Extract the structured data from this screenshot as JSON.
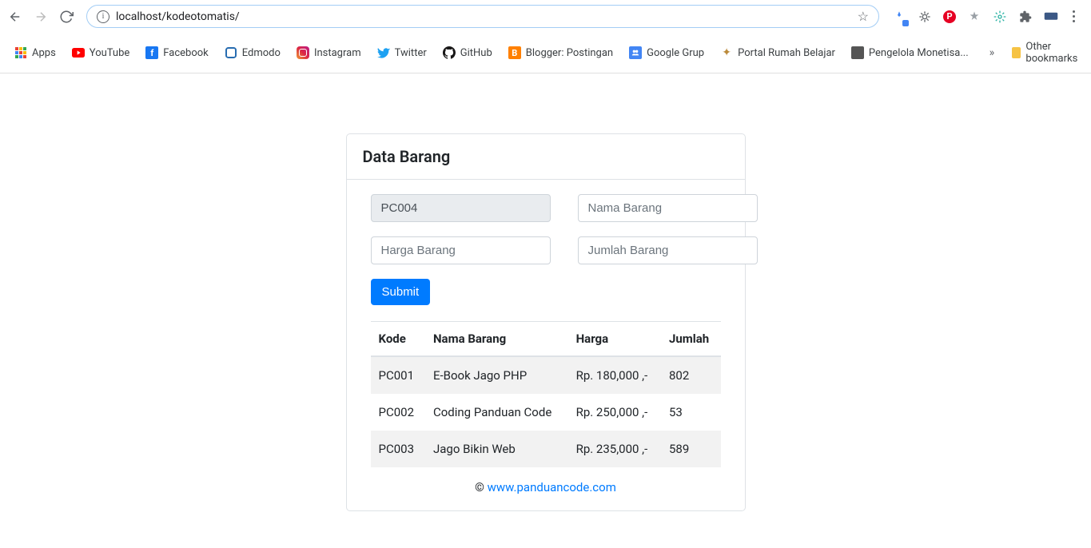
{
  "browser": {
    "url": "localhost/kodeotomatis/",
    "apps_label": "Apps",
    "other_bookmarks": "Other bookmarks"
  },
  "bookmarks": [
    {
      "label": "YouTube"
    },
    {
      "label": "Facebook"
    },
    {
      "label": "Edmodo"
    },
    {
      "label": "Instagram"
    },
    {
      "label": "Twitter"
    },
    {
      "label": "GitHub"
    },
    {
      "label": "Blogger: Postingan"
    },
    {
      "label": "Google Grup"
    },
    {
      "label": "Portal Rumah Belajar"
    },
    {
      "label": "Pengelola Monetisa..."
    }
  ],
  "card": {
    "title": "Data Barang",
    "kode_value": "PC004",
    "nama_placeholder": "Nama Barang",
    "harga_placeholder": "Harga Barang",
    "jumlah_placeholder": "Jumlah Barang",
    "submit_label": "Submit",
    "footer_copy": "© ",
    "footer_link": "www.panduancode.com"
  },
  "table": {
    "headers": {
      "kode": "Kode",
      "nama": "Nama Barang",
      "harga": "Harga",
      "jumlah": "Jumlah"
    },
    "rows": [
      {
        "kode": "PC001",
        "nama": "E-Book Jago PHP",
        "harga": "Rp. 180,000 ,-",
        "jumlah": "802"
      },
      {
        "kode": "PC002",
        "nama": "Coding Panduan Code",
        "harga": "Rp. 250,000 ,-",
        "jumlah": "53"
      },
      {
        "kode": "PC003",
        "nama": "Jago Bikin Web",
        "harga": "Rp. 235,000 ,-",
        "jumlah": "589"
      }
    ]
  }
}
